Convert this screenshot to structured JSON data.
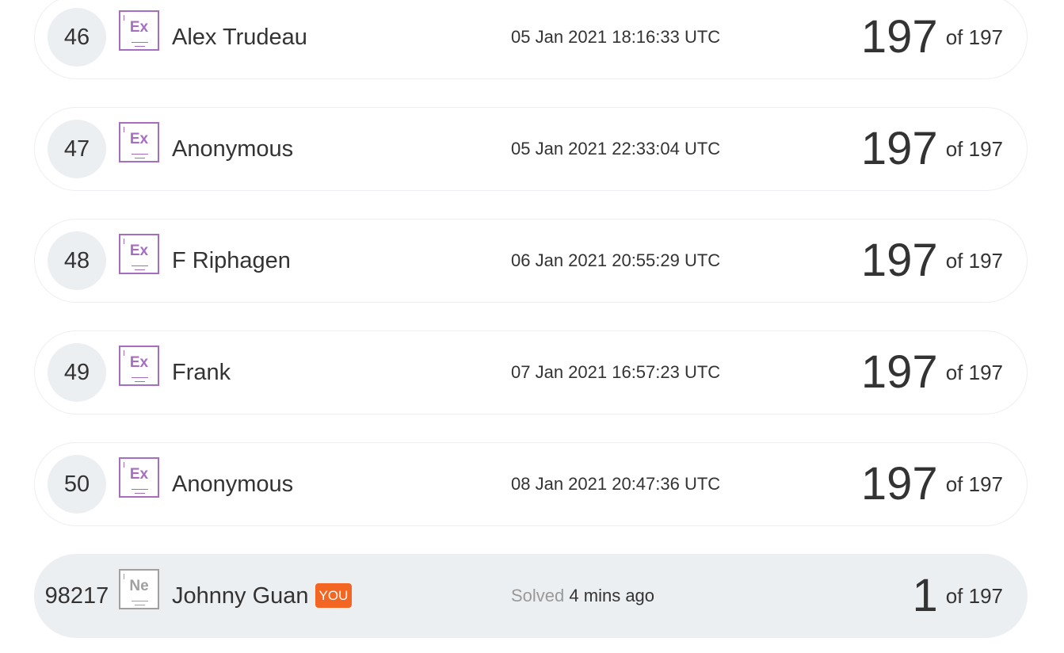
{
  "leaderboard": {
    "rows": [
      {
        "rank": "46",
        "badge_symbol": "Ex",
        "name": "Alex Trudeau",
        "time": "05 Jan 2021 18:16:33 UTC",
        "score": "197",
        "of_label": "of 197"
      },
      {
        "rank": "47",
        "badge_symbol": "Ex",
        "name": "Anonymous",
        "time": "05 Jan 2021 22:33:04 UTC",
        "score": "197",
        "of_label": "of 197"
      },
      {
        "rank": "48",
        "badge_symbol": "Ex",
        "name": "F Riphagen",
        "time": "06 Jan 2021 20:55:29 UTC",
        "score": "197",
        "of_label": "of 197"
      },
      {
        "rank": "49",
        "badge_symbol": "Ex",
        "name": "Frank",
        "time": "07 Jan 2021 16:57:23 UTC",
        "score": "197",
        "of_label": "of 197"
      },
      {
        "rank": "50",
        "badge_symbol": "Ex",
        "name": "Anonymous",
        "time": "08 Jan 2021 20:47:36 UTC",
        "score": "197",
        "of_label": "of 197"
      }
    ],
    "current_user": {
      "rank": "98217",
      "badge_symbol": "Ne",
      "name": "Johnny Guan",
      "you_label": "YOU",
      "solved_label": "Solved",
      "solved_time": "4 mins ago",
      "score": "1",
      "of_label": "of 197"
    },
    "colors": {
      "expert_badge": "#a56ec0",
      "newbie_badge": "#a0a0a0",
      "you_badge": "#f26522",
      "current_row_bg": "#eceff2"
    }
  }
}
